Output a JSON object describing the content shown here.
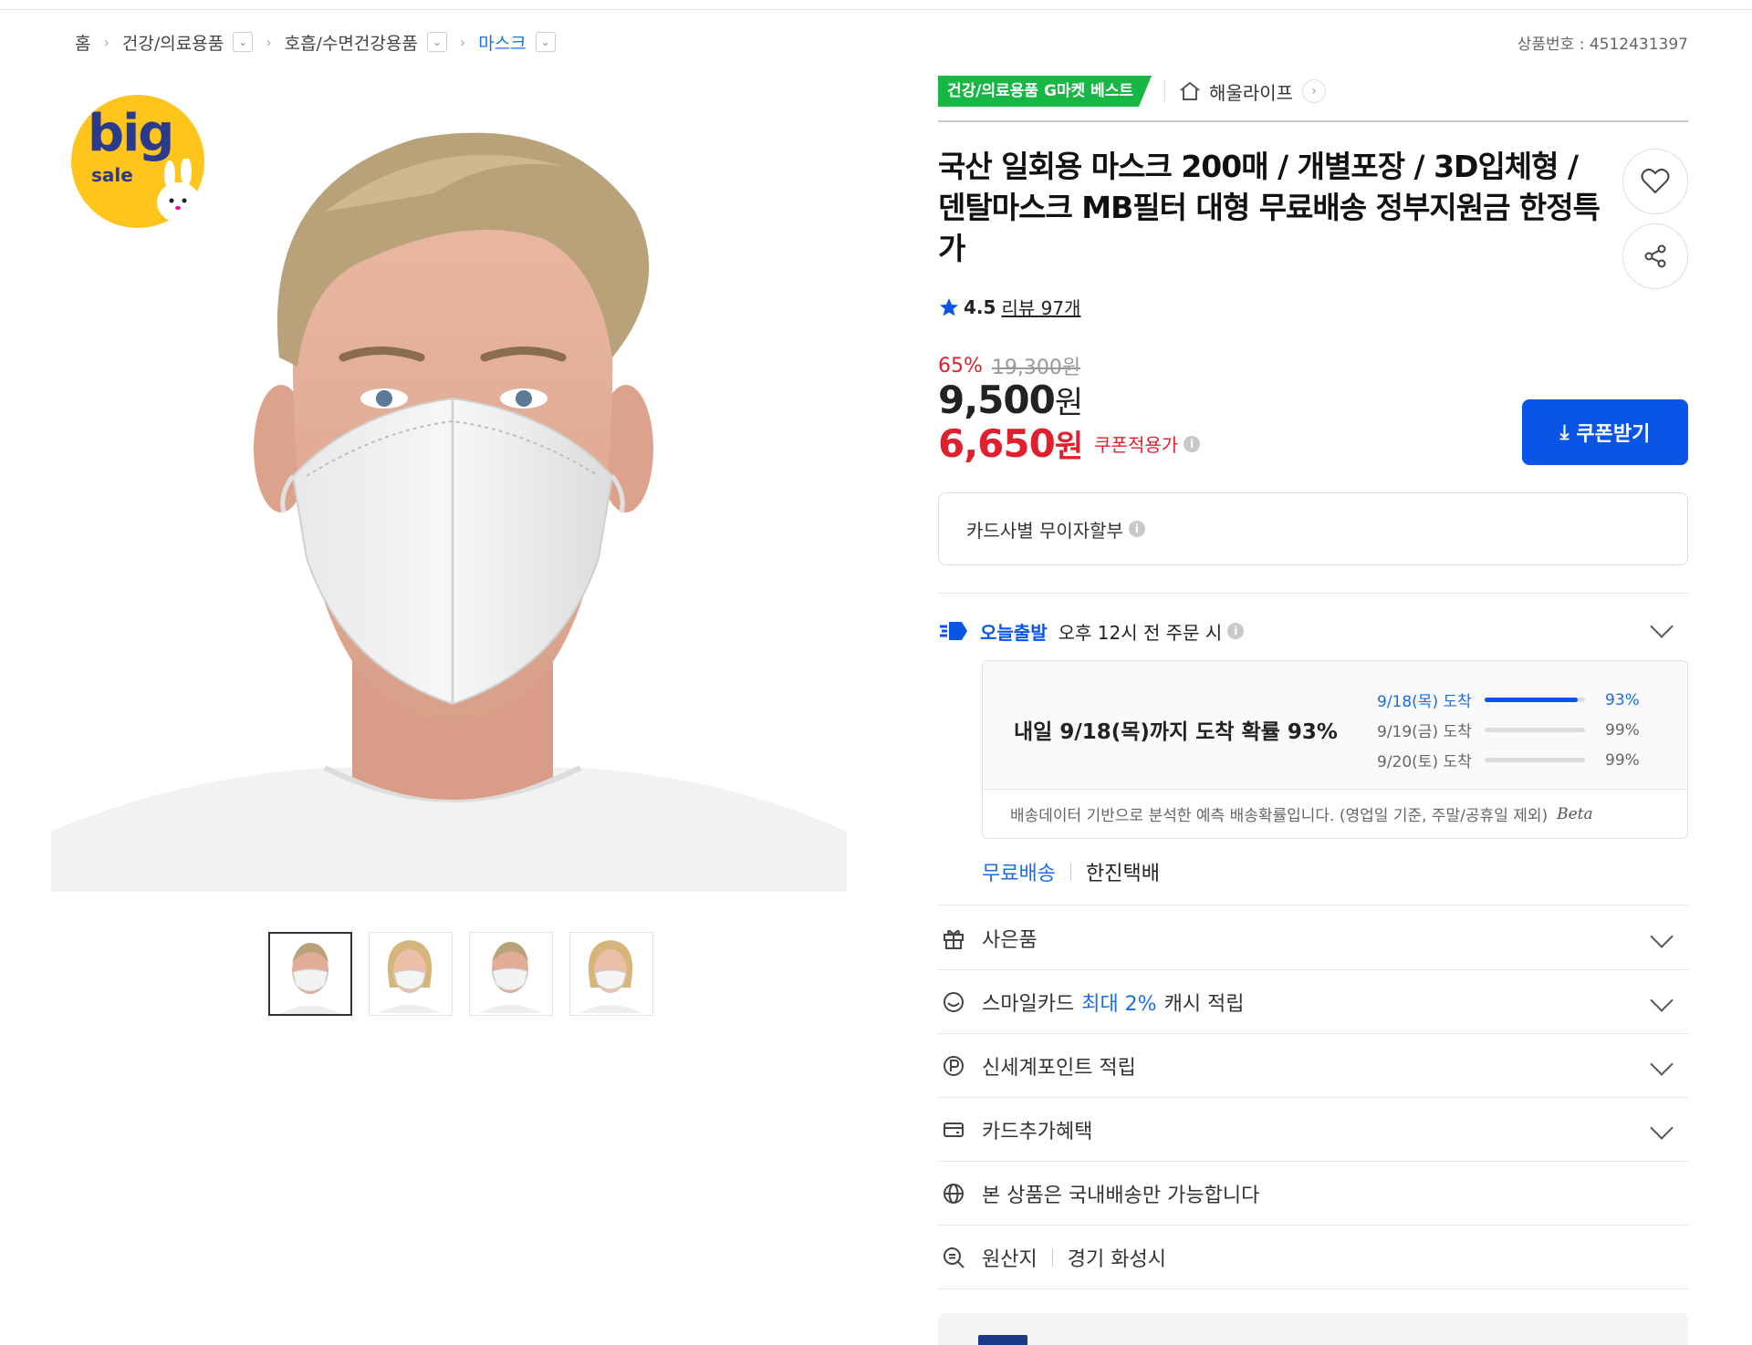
{
  "breadcrumb": {
    "items": [
      {
        "label": "홈"
      },
      {
        "label": "건강/의료용품"
      },
      {
        "label": "호흡/수면건강용품"
      },
      {
        "label": "마스크"
      }
    ]
  },
  "product_number": "상품번호 : 4512431397",
  "promo_badge": {
    "big": "big",
    "sale": "sale"
  },
  "best_badge": "건강/의료용품 G마켓 베스트",
  "store_name": "해울라이프",
  "title": "국산 일회용 마스크 200매 / 개별포장 / 3D입체형 / 덴탈마스크 MB필터 대형 무료배송 정부지원금 한정특가",
  "rating": {
    "score": "4.5",
    "reviews": "리뷰 97개"
  },
  "price": {
    "discount_rate": "65%",
    "original": "19,300원",
    "sale_value": "9,500",
    "coupon_value": "6,650",
    "won": "원",
    "coupon_label": "쿠폰적용가"
  },
  "coupon_button": "쿠폰받기",
  "installment": "카드사별 무이자할부",
  "today_ship": {
    "brand": "오늘출발",
    "condition": "오후 12시 전 주문 시"
  },
  "arrival": {
    "headline": "내일 9/18(목)까지 도착 확률 93%",
    "rows": [
      {
        "date": "9/18(목) 도착",
        "percent": "93%",
        "fraction": 0.93
      },
      {
        "date": "9/19(금) 도착",
        "percent": "99%",
        "fraction": 0.99
      },
      {
        "date": "9/20(토) 도착",
        "percent": "99%",
        "fraction": 0.99
      }
    ],
    "note": "배송데이터 기반으로 분석한 예측 배송확률입니다. (영업일 기준, 주말/공휴일 제외)",
    "beta": "Beta"
  },
  "shipping": {
    "fee": "무료배송",
    "carrier": "한진택배"
  },
  "benefits": {
    "gift": "사은품",
    "smile_prefix": "스마일카드",
    "smile_highlight": "최대 2%",
    "smile_suffix": "캐시 적립",
    "shinsegae": "신세계포인트 적립",
    "card_extra": "카드추가혜택",
    "domestic": "본 상품은 국내배송만 가능합니다",
    "origin_label": "원산지",
    "origin_value": "경기 화성시"
  },
  "colors": {
    "accent": "#0a55e8",
    "price_red": "#e0202e",
    "best_green": "#18b745",
    "promo_yellow": "#ffc51c"
  }
}
